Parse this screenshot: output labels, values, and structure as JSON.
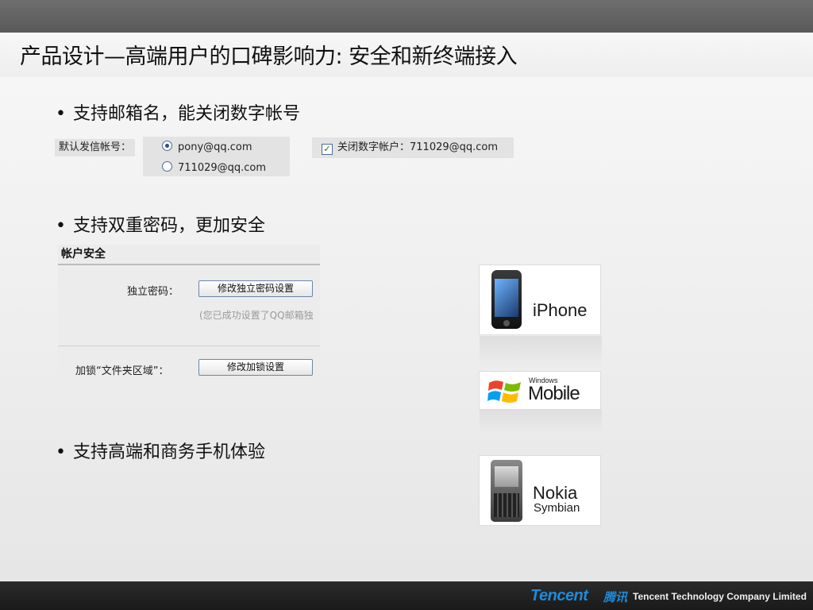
{
  "title": "产品设计—高端用户的口碑影响力: 安全和新终端接入",
  "bullets": [
    "支持邮箱名，能关闭数字帐号",
    "支持双重密码，更加安全",
    "支持高端和商务手机体验"
  ],
  "sender_settings": {
    "label": "默认发信帐号：",
    "options": [
      {
        "label": "pony@qq.com",
        "selected": true
      },
      {
        "label": "711029@qq.com",
        "selected": false
      }
    ],
    "close_numeric": {
      "label": "关闭数字帐户：711029@qq.com",
      "checked": true
    }
  },
  "account_security": {
    "header": "帐户安全",
    "independent_password_label": "独立密码：",
    "independent_password_button": "修改独立密码设置",
    "note": "(您已成功设置了QQ邮箱独",
    "lock_label": "加锁“文件夹区域”：",
    "lock_button": "修改加锁设置"
  },
  "devices": {
    "iphone": "iPhone",
    "windows_small": "Windows",
    "windows_mobile": "Mobile",
    "nokia": "Nokia",
    "symbian": "Symbian"
  },
  "footer": {
    "logo": "Tencent",
    "logo_cn": "腾讯",
    "company": "Tencent Technology Company Limited"
  },
  "colors": {
    "tencent_blue": "#1f8ad9",
    "top_bar": "#666666",
    "footer_bar": "#222222"
  }
}
